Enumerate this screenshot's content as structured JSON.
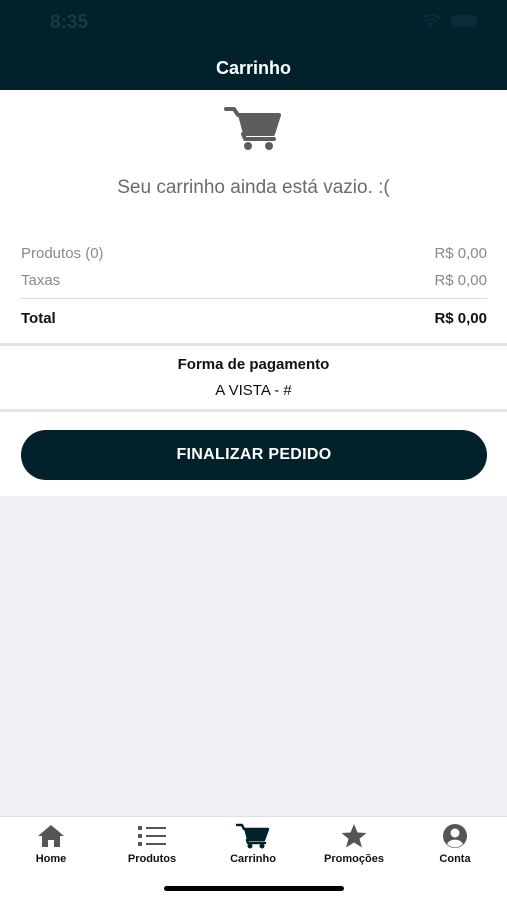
{
  "status": {
    "time": "8:35"
  },
  "header": {
    "title": "Carrinho"
  },
  "cart": {
    "empty_message": "Seu carrinho ainda está vazio. :(",
    "products_label": "Produtos (0)",
    "products_value": "R$ 0,00",
    "taxes_label": "Taxas",
    "taxes_value": "R$ 0,00",
    "total_label": "Total",
    "total_value": "R$ 0,00"
  },
  "payment": {
    "label": "Forma de pagamento",
    "value": "A VISTA - #"
  },
  "actions": {
    "finalize_label": "FINALIZAR PEDIDO"
  },
  "tabbar": {
    "items": [
      {
        "label": "Home",
        "icon": "home-icon"
      },
      {
        "label": "Produtos",
        "icon": "list-icon"
      },
      {
        "label": "Carrinho",
        "icon": "cart-icon"
      },
      {
        "label": "Promoções",
        "icon": "star-icon"
      },
      {
        "label": "Conta",
        "icon": "user-icon"
      }
    ]
  },
  "colors": {
    "primary": "#03212b",
    "background": "#efeff4",
    "muted_text": "#8a8a8a"
  }
}
